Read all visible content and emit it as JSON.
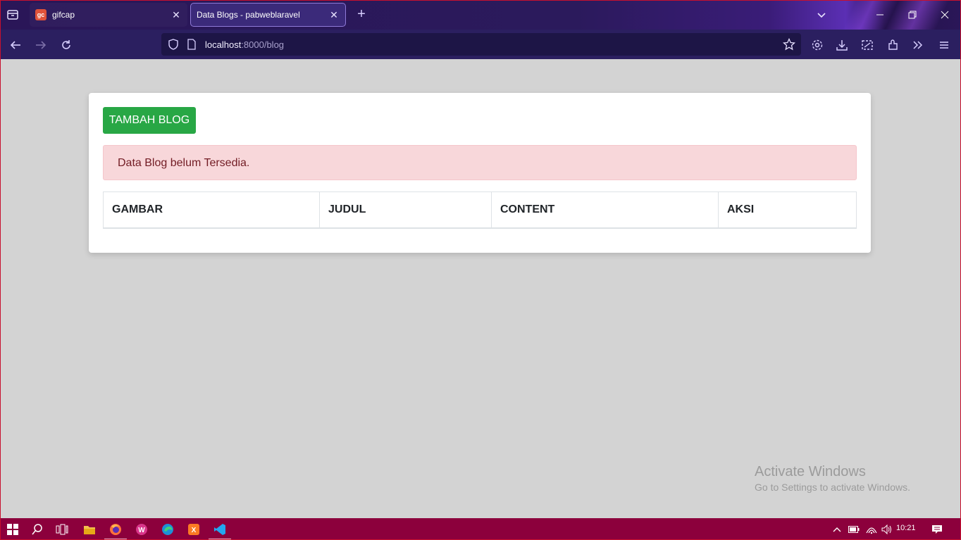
{
  "browser": {
    "tabs": [
      {
        "title": "gifcap",
        "favicon": "gifcap-favicon",
        "favicon_text": "gc"
      },
      {
        "title": "Data Blogs - pabweblaravel",
        "active": true
      }
    ],
    "url_host": "localhost",
    "url_rest": ":8000/blog",
    "accent": "#2b1f60"
  },
  "page": {
    "add_button": "TAMBAH BLOG",
    "alert": "Data Blog belum Tersedia.",
    "table_headers": [
      "GAMBAR",
      "JUDUL",
      "CONTENT",
      "AKSI"
    ],
    "button_color": "#28a745",
    "alert_color": "#f8d7da"
  },
  "watermark": {
    "line1": "Activate Windows",
    "line2": "Go to Settings to activate Windows."
  },
  "taskbar": {
    "apps": [
      "windows-start-icon",
      "search-icon",
      "task-view-icon",
      "file-explorer-icon",
      "firefox-icon",
      "wps-office-icon",
      "edge-icon",
      "xampp-icon",
      "vscode-icon"
    ],
    "time": "10:21",
    "color": "#8c003c"
  }
}
